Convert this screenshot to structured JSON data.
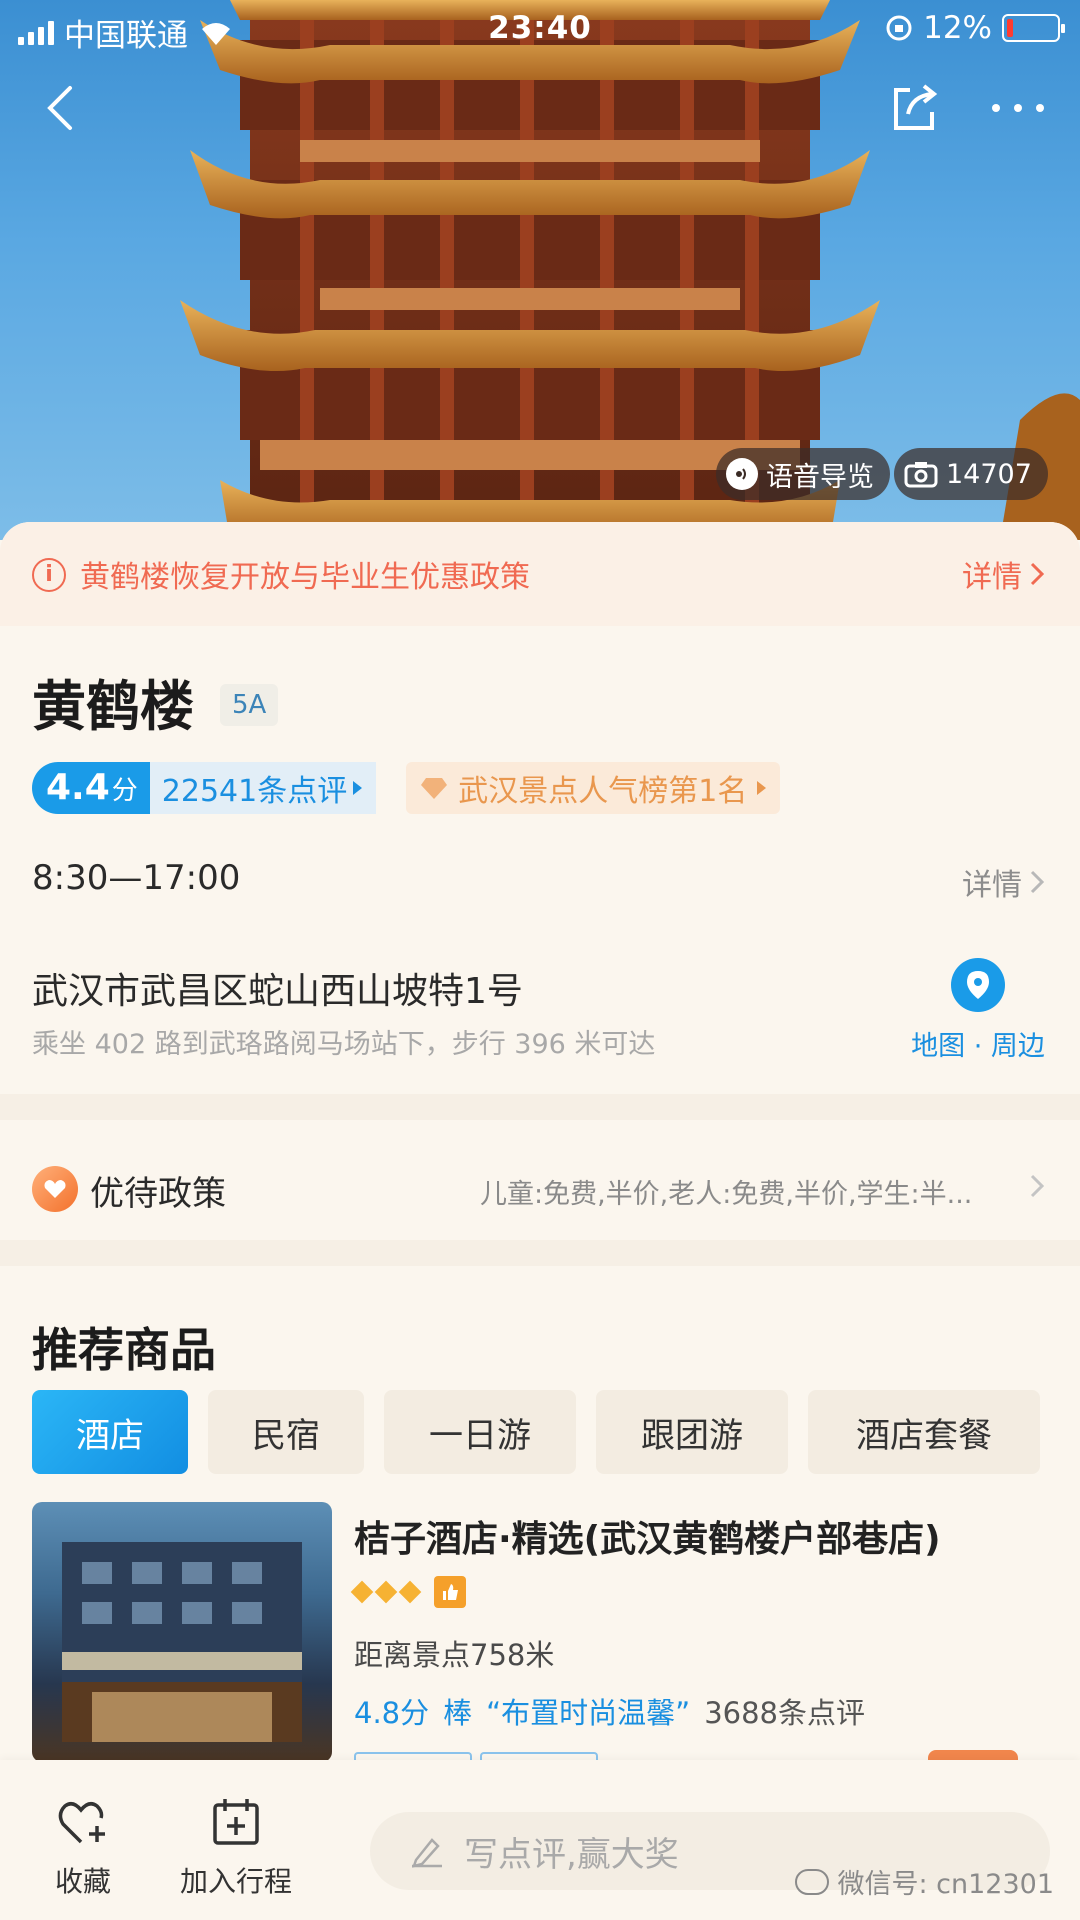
{
  "status_bar": {
    "carrier": "中国联通",
    "time": "23:40",
    "battery": "12%"
  },
  "hero": {
    "audio_guide_label": "语音导览",
    "photo_count": "14707"
  },
  "notice": {
    "text": "黄鹤楼恢复开放与毕业生优惠政策",
    "more_label": "详情"
  },
  "attraction": {
    "name": "黄鹤楼",
    "level": "5A",
    "score": "4.4",
    "score_unit": "分",
    "reviews": "22541条点评",
    "ranking": "武汉景点人气榜第1名",
    "hours": "8:30—17:00",
    "hours_more": "详情",
    "address": "武汉市武昌区蛇山西山坡特1号",
    "transit": "乘坐 402 路到武珞路阅马场站下，步行 396 米可达",
    "map_label": "地图 · 周边"
  },
  "policy": {
    "title": "优待政策",
    "desc": "儿童:免费,半价,老人:免费,半价,学生:半..."
  },
  "recommend": {
    "title": "推荐商品",
    "tabs": [
      {
        "label": "酒店"
      },
      {
        "label": "民宿"
      },
      {
        "label": "一日游"
      },
      {
        "label": "跟团游"
      },
      {
        "label": "酒店套餐"
      }
    ],
    "hotel": {
      "name": "桔子酒店·精选(武汉黄鹤楼户部巷店)",
      "distance": "距离景点758米",
      "score": "4.8分",
      "quality": "棒",
      "quote": "“布置时尚温馨”",
      "reviews": "3688条点评",
      "diamond_count": 3
    }
  },
  "bottom_bar": {
    "favorite_label": "收藏",
    "add_trip_label": "加入行程",
    "review_placeholder": "写点评,赢大奖",
    "watermark": "微信号: cn12301"
  },
  "colors": {
    "accent_blue": "#1a9be8",
    "notice_red": "#f06a52",
    "rank_orange": "#e9974e",
    "background": "#fbf6ee"
  }
}
